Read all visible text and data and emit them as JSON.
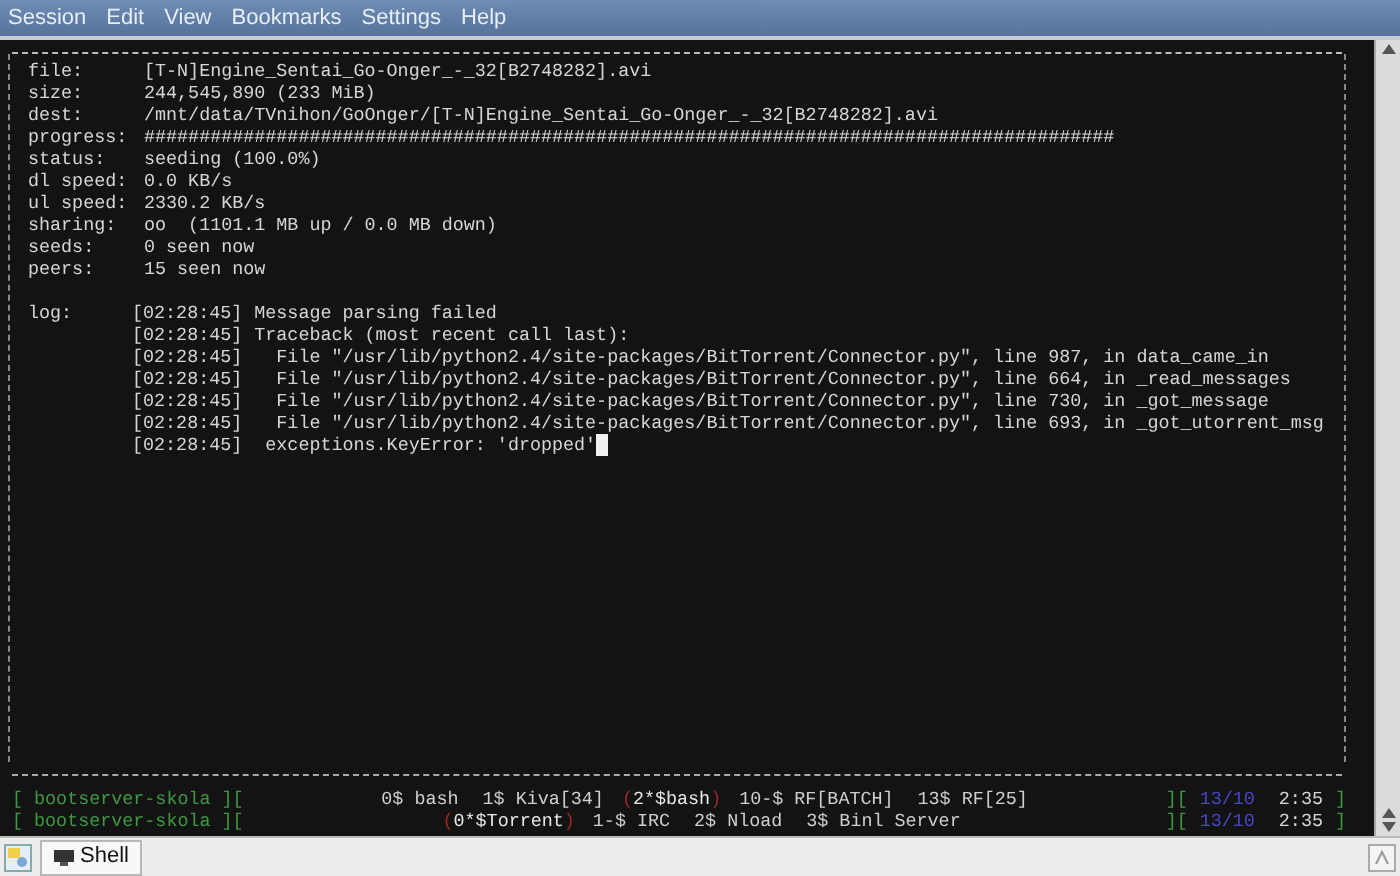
{
  "menu": [
    "Session",
    "Edit",
    "View",
    "Bookmarks",
    "Settings",
    "Help"
  ],
  "fields": [
    {
      "label": "file:",
      "value": "[T-N]Engine_Sentai_Go-Onger_-_32[B2748282].avi"
    },
    {
      "label": "size:",
      "value": "244,545,890 (233 MiB)"
    },
    {
      "label": "dest:",
      "value": "/mnt/data/TVnihon/GoOnger/[T-N]Engine_Sentai_Go-Onger_-_32[B2748282].avi"
    },
    {
      "label": "progress:",
      "value": "########################################################################################"
    },
    {
      "label": "status:",
      "value": "seeding (100.0%)"
    },
    {
      "label": "dl speed:",
      "value": "0.0 KB/s"
    },
    {
      "label": "ul speed:",
      "value": "2330.2 KB/s"
    },
    {
      "label": "sharing:",
      "value": "oo  (1101.1 MB up / 0.0 MB down)"
    },
    {
      "label": "seeds:",
      "value": "0 seen now"
    },
    {
      "label": "peers:",
      "value": "15 seen now"
    }
  ],
  "log": {
    "label": "log:",
    "entries": [
      {
        "time": "[02:28:45]",
        "message": "Message parsing failed"
      },
      {
        "time": "[02:28:45]",
        "message": "Traceback (most recent call last):"
      },
      {
        "time": "[02:28:45]",
        "message": "  File \"/usr/lib/python2.4/site-packages/BitTorrent/Connector.py\", line 987, in data_came_in"
      },
      {
        "time": "[02:28:45]",
        "message": "  File \"/usr/lib/python2.4/site-packages/BitTorrent/Connector.py\", line 664, in _read_messages"
      },
      {
        "time": "[02:28:45]",
        "message": "  File \"/usr/lib/python2.4/site-packages/BitTorrent/Connector.py\", line 730, in _got_message"
      },
      {
        "time": "[02:28:45]",
        "message": "  File \"/usr/lib/python2.4/site-packages/BitTorrent/Connector.py\", line 693, in _got_utorrent_msg"
      },
      {
        "time": "[02:28:45]",
        "message": " exceptions.KeyError: 'dropped'"
      }
    ]
  },
  "screen_bar": {
    "rows": [
      {
        "host": "[ bootserver-skola ][",
        "windows": [
          {
            "label": "0$ bash",
            "selected": false
          },
          {
            "label": "1$ Kiva[34]",
            "selected": false
          },
          {
            "label": "2*$bash",
            "selected": true
          },
          {
            "label": "10-$ RF[BATCH]",
            "selected": false
          },
          {
            "label": "13$ RF[25]",
            "selected": false
          }
        ],
        "open": "][",
        "date": "13/10",
        "time": "2:35",
        "close": "]"
      },
      {
        "host": "[ bootserver-skola ][",
        "windows": [
          {
            "label": "0*$Torrent",
            "selected": true
          },
          {
            "label": "1-$ IRC",
            "selected": false
          },
          {
            "label": "2$ Nload",
            "selected": false
          },
          {
            "label": "3$ Binl Server",
            "selected": false
          }
        ],
        "open": "][",
        "date": "13/10",
        "time": "2:35",
        "close": "]"
      }
    ],
    "sel_open": "(",
    "sel_close": ")"
  },
  "tabs": [
    {
      "label": "Shell",
      "selected": true
    }
  ]
}
